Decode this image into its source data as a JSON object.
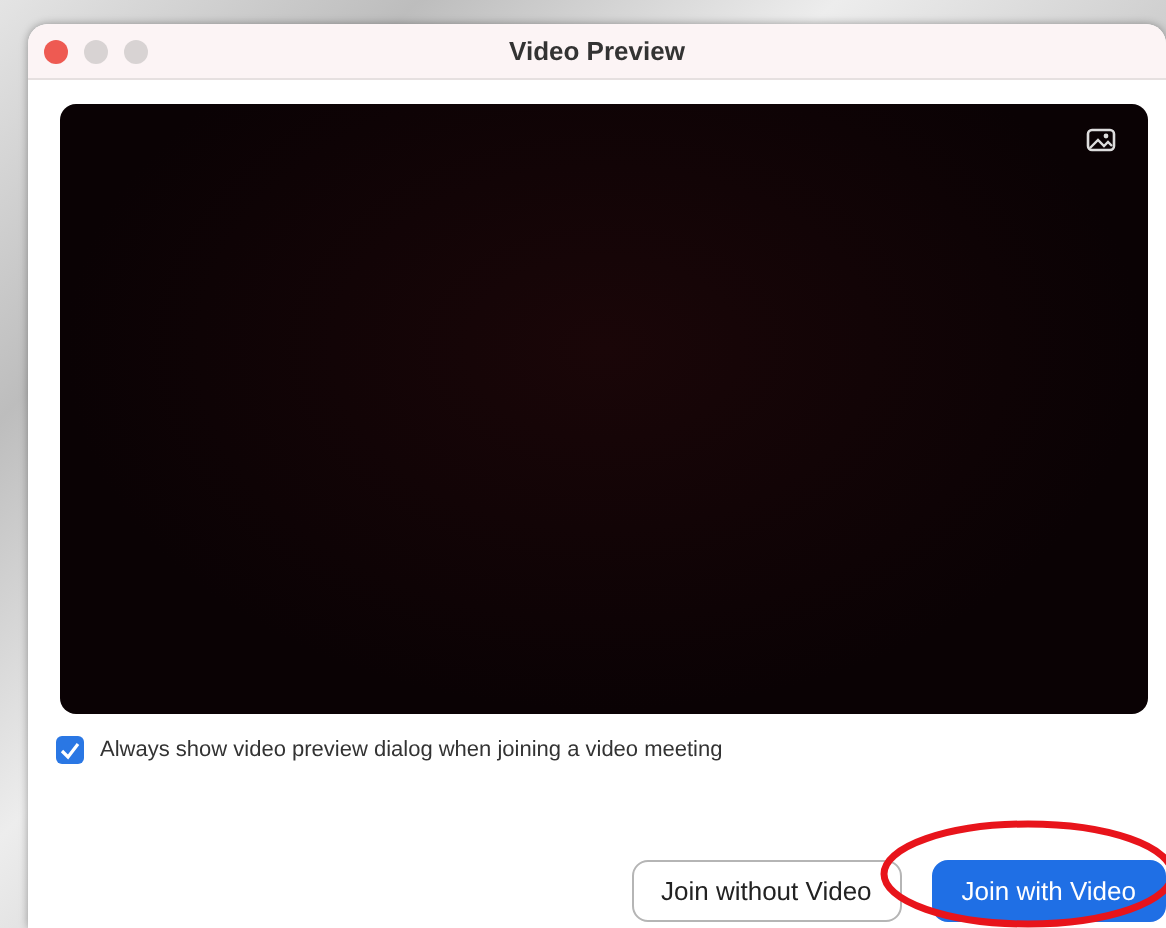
{
  "window": {
    "title": "Video Preview",
    "controls": [
      {
        "kind": "close"
      },
      {
        "kind": "minimize"
      },
      {
        "kind": "zoom"
      }
    ]
  },
  "preview": {
    "kind": "camera-off"
  },
  "checkbox": {
    "label": "Always show video preview dialog when joining a video meeting",
    "checked": true
  },
  "buttons": [
    {
      "label": "Join without Video",
      "kind": "secondary"
    },
    {
      "label": "Join with Video",
      "kind": "primary"
    }
  ],
  "annotation": {
    "kind": "ellipse"
  }
}
